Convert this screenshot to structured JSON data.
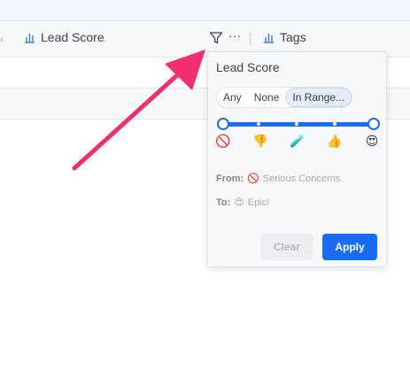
{
  "header": {
    "left_caret": "‹",
    "columns": [
      {
        "label": "Lead Score",
        "icon": "bar-chart-icon"
      },
      {
        "label": "Tags",
        "icon": "bar-chart-icon"
      }
    ],
    "more": "···",
    "filter_icon": "filter-funnel-icon"
  },
  "popover": {
    "title": "Lead Score",
    "segments": [
      {
        "label": "Any",
        "active": false
      },
      {
        "label": "None",
        "active": false
      },
      {
        "label": "In Range...",
        "active": true
      }
    ],
    "range": {
      "min_index": 0,
      "max_index": 4,
      "steps": 5
    },
    "emoji_scale": [
      "🚫",
      "👎",
      "🧪",
      "👍",
      "😍"
    ],
    "from": {
      "label": "From:",
      "emoji": "🚫",
      "value": "Serious Concerns."
    },
    "to": {
      "label": "To:",
      "emoji": "😍",
      "value": "Epic!"
    },
    "clear_label": "Clear",
    "apply_label": "Apply"
  },
  "colors": {
    "accent": "#1a6df0",
    "annotation_arrow": "#f0306e"
  }
}
